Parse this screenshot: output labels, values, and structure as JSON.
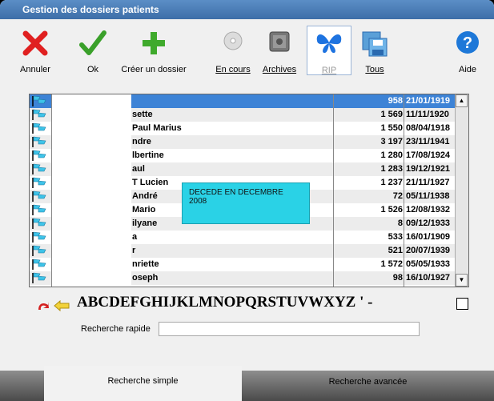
{
  "window": {
    "title": "Gestion des dossiers patients"
  },
  "toolbar": {
    "annuler": "Annuler",
    "ok": "Ok",
    "creer": "Créer un dossier",
    "en_cours": "En cours",
    "archives": "Archives",
    "rip": "RIP",
    "tous": "Tous",
    "aide": "Aide"
  },
  "rows": [
    {
      "name": "",
      "num": "958",
      "date": "21/01/1919",
      "selected": true
    },
    {
      "name": "sette",
      "num": "1 569",
      "date": "11/11/1920"
    },
    {
      "name": "Paul Marius",
      "num": "1 550",
      "date": "08/04/1918"
    },
    {
      "name": "ndre",
      "num": "3 197",
      "date": "23/11/1941"
    },
    {
      "name": "lbertine",
      "num": "1 280",
      "date": "17/08/1924"
    },
    {
      "name": "aul",
      "num": "1 283",
      "date": "19/12/1921"
    },
    {
      "name": "T Lucien",
      "num": "1 237",
      "date": "21/11/1927"
    },
    {
      "name": "André",
      "num": "72",
      "date": "05/11/1938"
    },
    {
      "name": "Mario",
      "num": "1 526",
      "date": "12/08/1932"
    },
    {
      "name": "ilyane",
      "num": "8",
      "date": "09/12/1933"
    },
    {
      "name": "a",
      "num": "533",
      "date": "16/01/1909"
    },
    {
      "name": "r",
      "num": "521",
      "date": "20/07/1939"
    },
    {
      "name": "nriette",
      "num": "1 572",
      "date": "05/05/1933"
    },
    {
      "name": "oseph",
      "num": "98",
      "date": "16/10/1927"
    }
  ],
  "tooltip": "DECEDE EN DECEMBRE 2008",
  "alphabet": "ABCDEFGHIJKLMNOPQRSTUVWXYZ ' -",
  "search": {
    "label": "Recherche rapide",
    "value": ""
  },
  "tabs": {
    "simple": "Recherche simple",
    "avancee": "Recherche avancée"
  }
}
